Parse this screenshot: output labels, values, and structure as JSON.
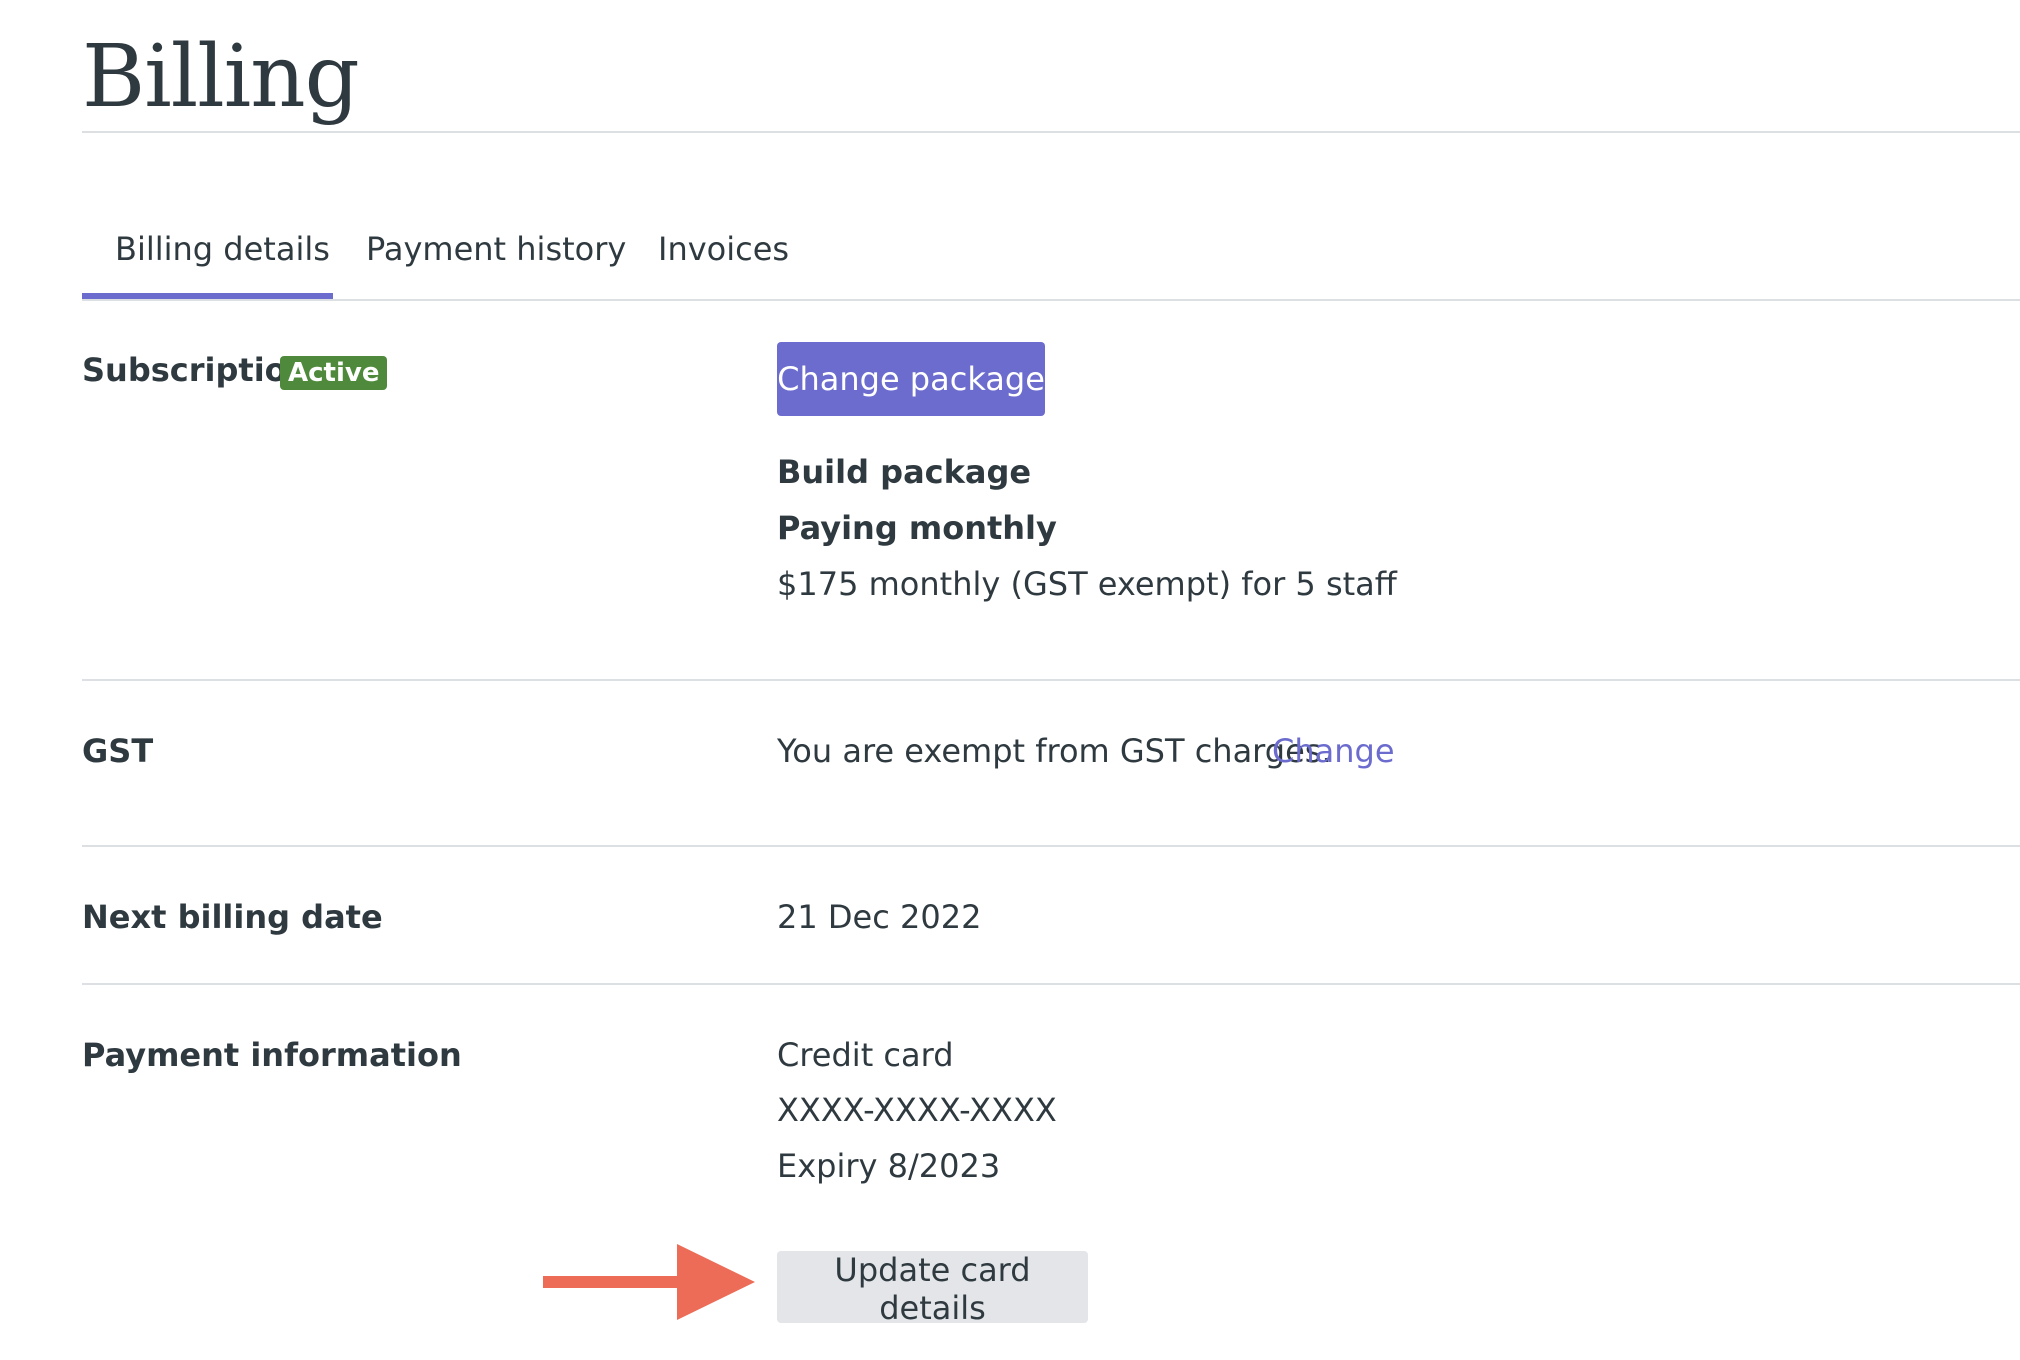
{
  "page": {
    "title": "Billing"
  },
  "tabs": [
    {
      "label": "Billing details",
      "active": true
    },
    {
      "label": "Payment history",
      "active": false
    },
    {
      "label": "Invoices",
      "active": false
    }
  ],
  "subscription": {
    "label": "Subscription",
    "status_badge": "Active",
    "change_button": "Change package",
    "package_name": "Build package",
    "billing_cycle": "Paying monthly",
    "price_summary": "$175 monthly (GST exempt) for 5 staff"
  },
  "gst": {
    "label": "GST",
    "text": "You are exempt from GST charges.",
    "change_link": "Change"
  },
  "next_billing": {
    "label": "Next billing date",
    "value": "21 Dec 2022"
  },
  "payment": {
    "label": "Payment information",
    "method": "Credit card",
    "card_number": "XXXX-XXXX-XXXX-",
    "expiry": "Expiry 8/2023",
    "update_button": "Update card details"
  },
  "colors": {
    "accent": "#6b6cce",
    "badge": "#4f8a3c",
    "annotation_arrow": "#ec6c58",
    "secondary_button": "#e3e5e8"
  },
  "icons": {
    "annotation": "right-arrow-icon"
  }
}
